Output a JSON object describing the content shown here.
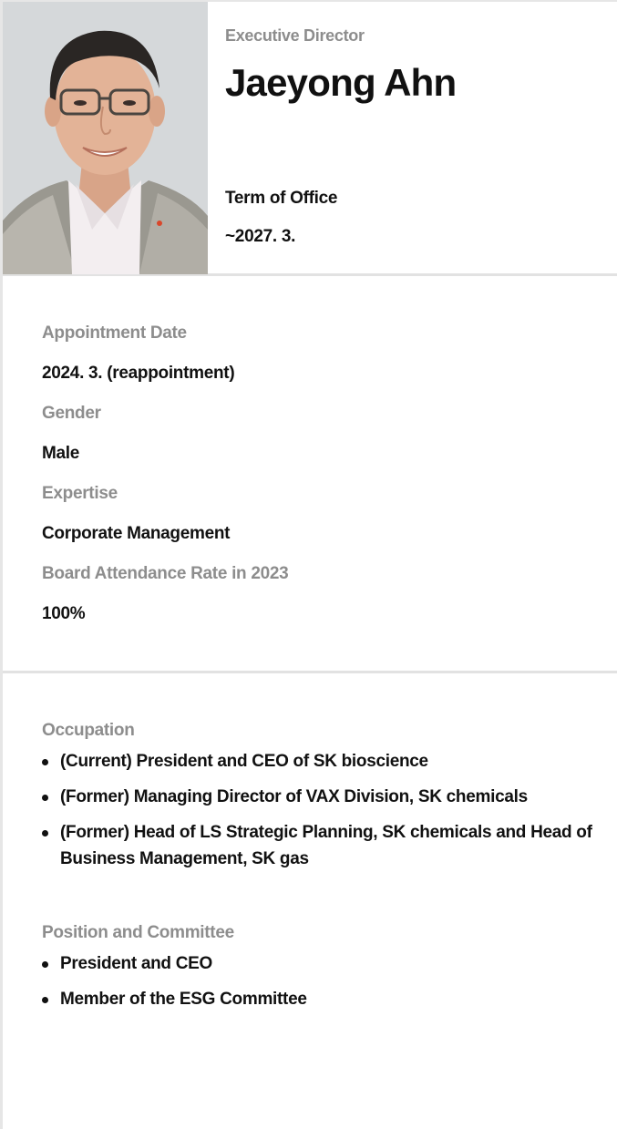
{
  "profile": {
    "role": "Executive Director",
    "name": "Jaeyong Ahn",
    "term_label": "Term of Office",
    "term_value": "~2027. 3."
  },
  "details": [
    {
      "label": "Appointment Date",
      "value": "2024. 3. (reappointment)"
    },
    {
      "label": "Gender",
      "value": "Male"
    },
    {
      "label": "Expertise",
      "value": "Corporate Management"
    },
    {
      "label": "Board Attendance Rate in 2023",
      "value": "100%"
    }
  ],
  "occupation": {
    "label": "Occupation",
    "items": [
      "(Current) President and CEO of SK bioscience",
      "(Former) Managing Director of VAX Division, SK chemicals",
      "(Former) Head of LS Strategic Planning, SK chemicals and Head of Business Management, SK gas"
    ]
  },
  "position": {
    "label": "Position and Committee",
    "items": [
      "President and CEO",
      "Member of the ESG Committee"
    ]
  }
}
